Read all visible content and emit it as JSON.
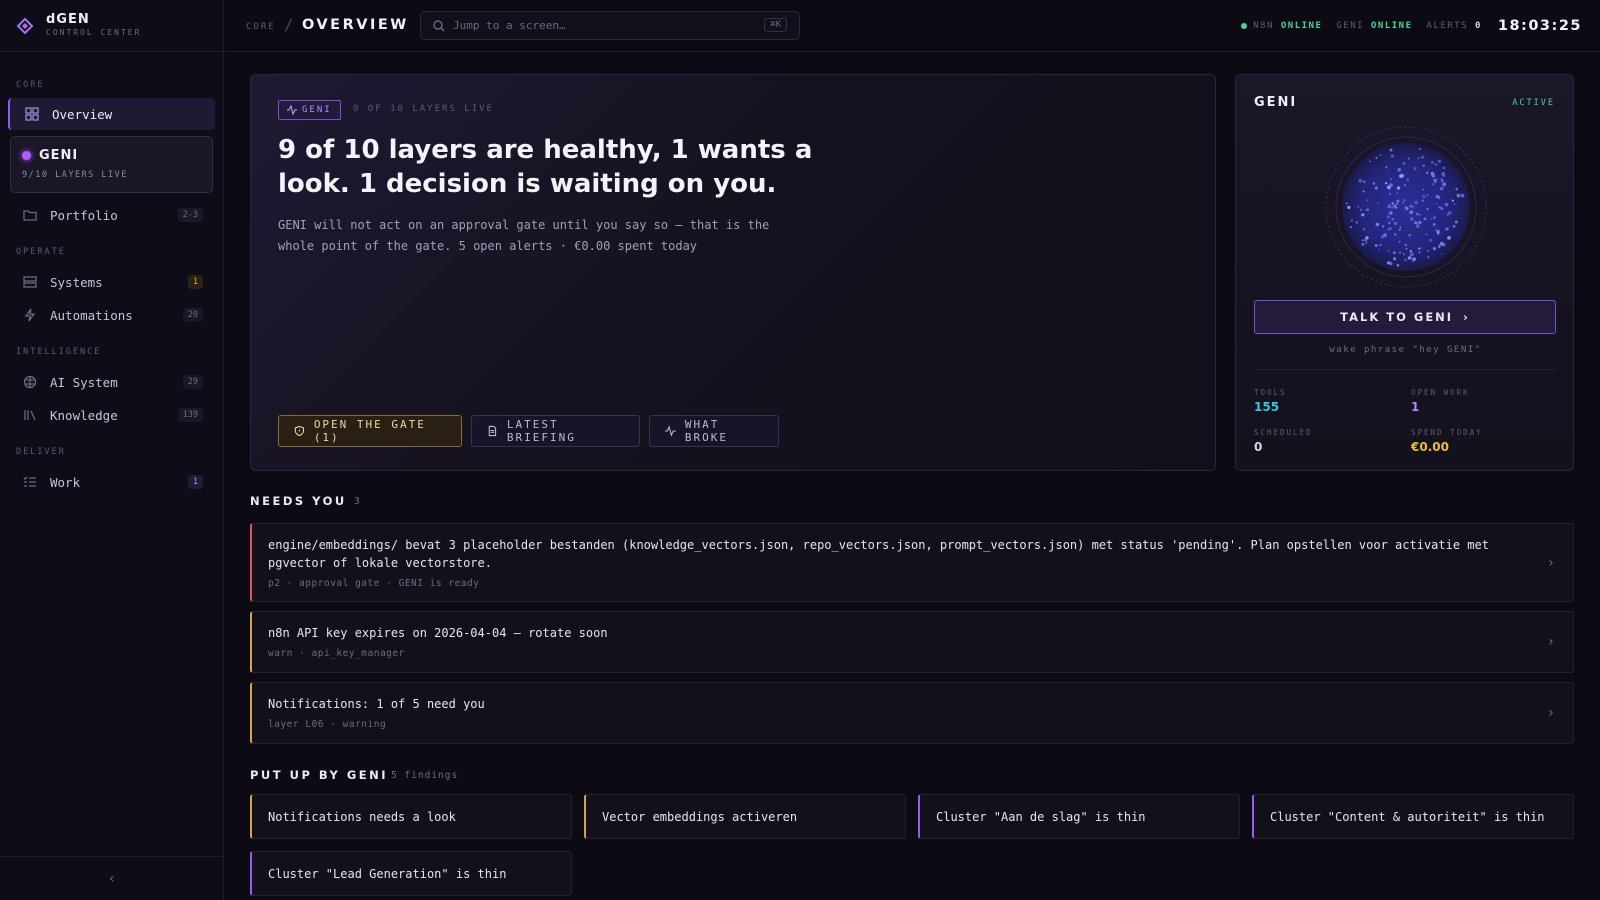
{
  "app": {
    "name": "dGEN",
    "subtitle": "CONTROL CENTER"
  },
  "sidebar": {
    "sections": [
      "CORE",
      "OPERATE",
      "INTELLIGENCE",
      "DELIVER"
    ],
    "overview_label": "Overview",
    "geni": {
      "name": "GENI",
      "status": "9/10 LAYERS LIVE"
    },
    "items": [
      {
        "label": "Portfolio",
        "badge": "2-3"
      },
      {
        "label": "Systems",
        "badge": "1"
      },
      {
        "label": "Automations",
        "badge": "20"
      },
      {
        "label": "AI System",
        "badge": "29"
      },
      {
        "label": "Knowledge",
        "badge": "139"
      },
      {
        "label": "Work",
        "badge": "1"
      }
    ],
    "collapse": "‹"
  },
  "topbar": {
    "crumb": "CORE",
    "separator": "/",
    "title": "OVERVIEW",
    "search_placeholder": "Jump to a screen…",
    "search_kbd": "⌘K",
    "n8n_label": "N8N",
    "n8n_status": "ONLINE",
    "geni_label": "GENI",
    "geni_status": "ONLINE",
    "alerts_label": "ALERTS",
    "alerts_count": "0",
    "clock": "18:03:25"
  },
  "hero": {
    "chip": "GENI",
    "chip_meta": "9 OF 10 LAYERS LIVE",
    "headline": "9 of 10 layers are healthy, 1 wants a look. 1 decision is waiting on you.",
    "body": "GENI will not act on an approval gate until you say so — that is the whole point of the gate. 5 open alerts · €0.00 spent today",
    "buttons": {
      "gate": "OPEN THE GATE (1)",
      "briefing": "LATEST BRIEFING",
      "broke": "WHAT BROKE"
    }
  },
  "geni_panel": {
    "title": "GENI",
    "state": "ACTIVE",
    "talk_label": "TALK TO GENI",
    "wake_phrase": "wake phrase \"hey GENI\"",
    "stats": {
      "tools_label": "TOOLS",
      "tools": "155",
      "open_work_label": "OPEN WORK",
      "open_work": "1",
      "scheduled_label": "SCHEDULED",
      "scheduled": "0",
      "spend_label": "SPEND TODAY",
      "spend": "€0.00"
    },
    "colors": {
      "tools": "#35c7e8",
      "open_work": "#b683ff",
      "scheduled": "#d8d6e6",
      "spend": "#f0b93a"
    }
  },
  "needs_you": {
    "title": "NEEDS YOU",
    "count": "3",
    "items": [
      {
        "text": "engine/embeddings/ bevat 3 placeholder bestanden (knowledge_vectors.json, repo_vectors.json, prompt_vectors.json) met status 'pending'. Plan opstellen voor activatie met pgvector of lokale vectorstore.",
        "meta": "p2 · approval gate · GENI is ready",
        "accent": "#e0526b"
      },
      {
        "text": "n8n API key expires on 2026-04-04 — rotate soon",
        "meta": "warn · api_key_manager",
        "accent": "#d7a545"
      },
      {
        "text": "Notifications: 1 of 5 need you",
        "meta": "layer L06 · warning",
        "accent": "#d7a545"
      }
    ]
  },
  "findings": {
    "title": "PUT UP BY GENI",
    "count": "5 findings",
    "items": [
      {
        "text": "Notifications needs a look",
        "accent": "#d7a545"
      },
      {
        "text": "Vector embeddings activeren",
        "accent": "#d7a545"
      },
      {
        "text": "Cluster \"Aan de slag\" is thin",
        "accent": "#9a5cf0"
      },
      {
        "text": "Cluster \"Content & autoriteit\" is thin",
        "accent": "#9a5cf0"
      },
      {
        "text": "Cluster \"Lead Generation\" is thin",
        "accent": "#9a5cf0"
      }
    ]
  }
}
